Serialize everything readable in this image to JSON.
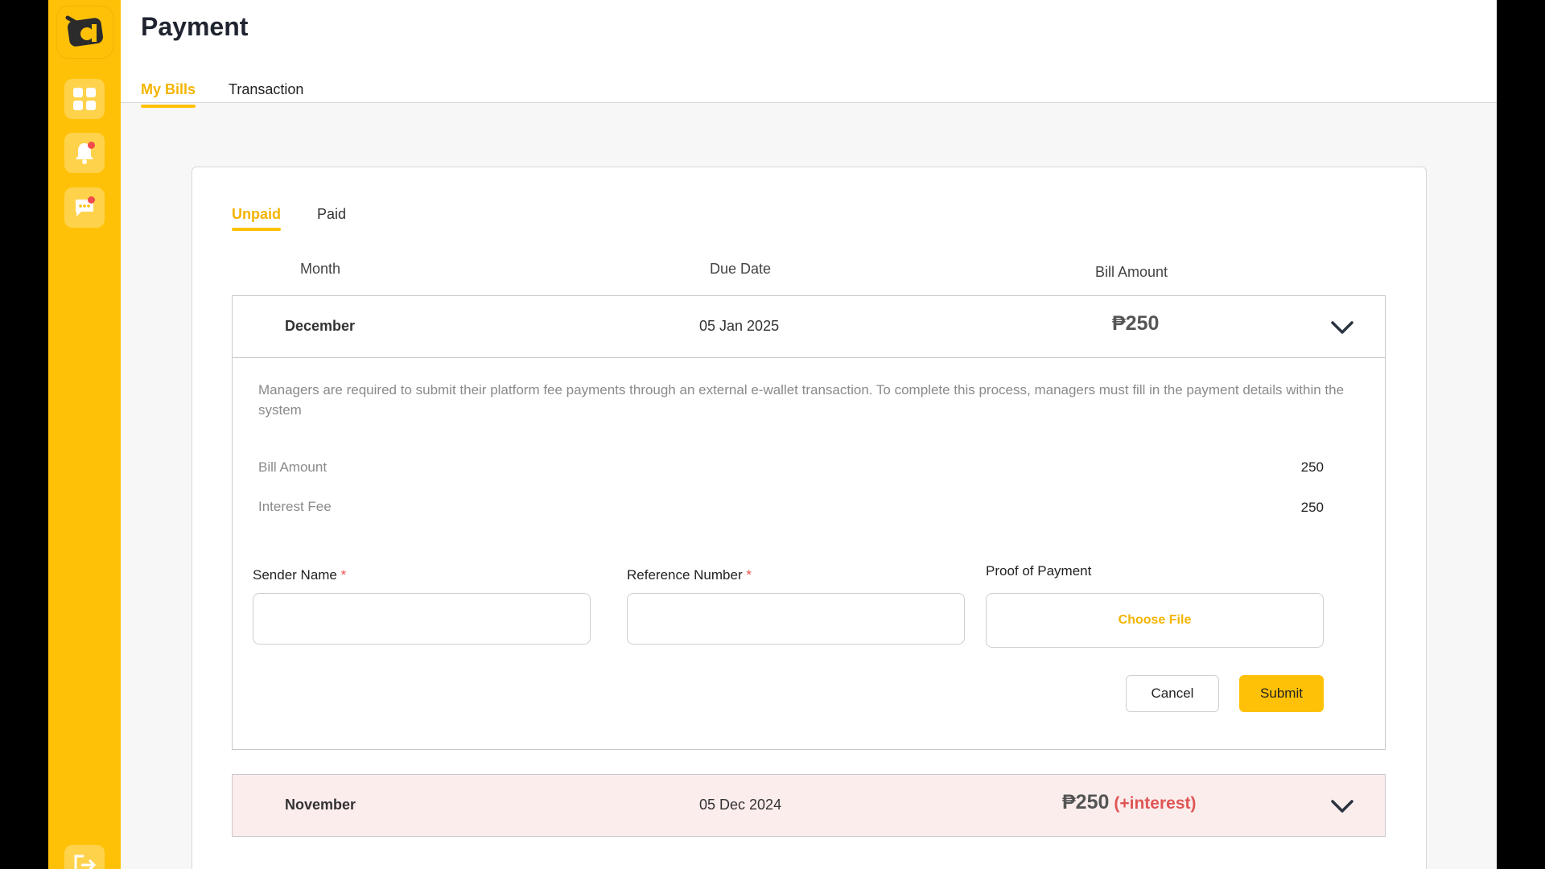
{
  "page": {
    "title": "Payment"
  },
  "tabs": {
    "my_bills": "My Bills",
    "transaction": "Transaction"
  },
  "subtabs": {
    "unpaid": "Unpaid",
    "paid": "Paid"
  },
  "columns": {
    "month": "Month",
    "due_date": "Due Date",
    "bill_amount": "Bill Amount"
  },
  "bills": [
    {
      "month": "December",
      "due_date": "05 Jan 2025",
      "amount": "₱250",
      "interest_tag": ""
    },
    {
      "month": "November",
      "due_date": "05 Dec 2024",
      "amount": "₱250",
      "interest_tag": "(+interest)"
    }
  ],
  "detail": {
    "description": "Managers are required to submit their platform fee payments through an external e-wallet transaction. To complete this process, managers must fill in the payment details within the system",
    "bill_amount_label": "Bill Amount",
    "bill_amount_value": "250",
    "interest_fee_label": "Interest Fee",
    "interest_fee_value": "250"
  },
  "form": {
    "sender_name_label": "Sender Name",
    "reference_number_label": "Reference Number",
    "proof_label": "Proof of Payment",
    "required_mark": "*",
    "choose_file": "Choose File",
    "cancel": "Cancel",
    "submit": "Submit"
  },
  "colors": {
    "accent": "#FFC107",
    "accent_text": "#F4B400",
    "warning_row": "#FCEDED",
    "interest_text": "#E05555"
  },
  "icons": {
    "logo": "app-logo-icon",
    "dashboard": "grid-icon",
    "notifications": "bell-icon",
    "messages": "chat-icon",
    "logout": "logout-icon",
    "expand": "chevron-down-icon"
  }
}
